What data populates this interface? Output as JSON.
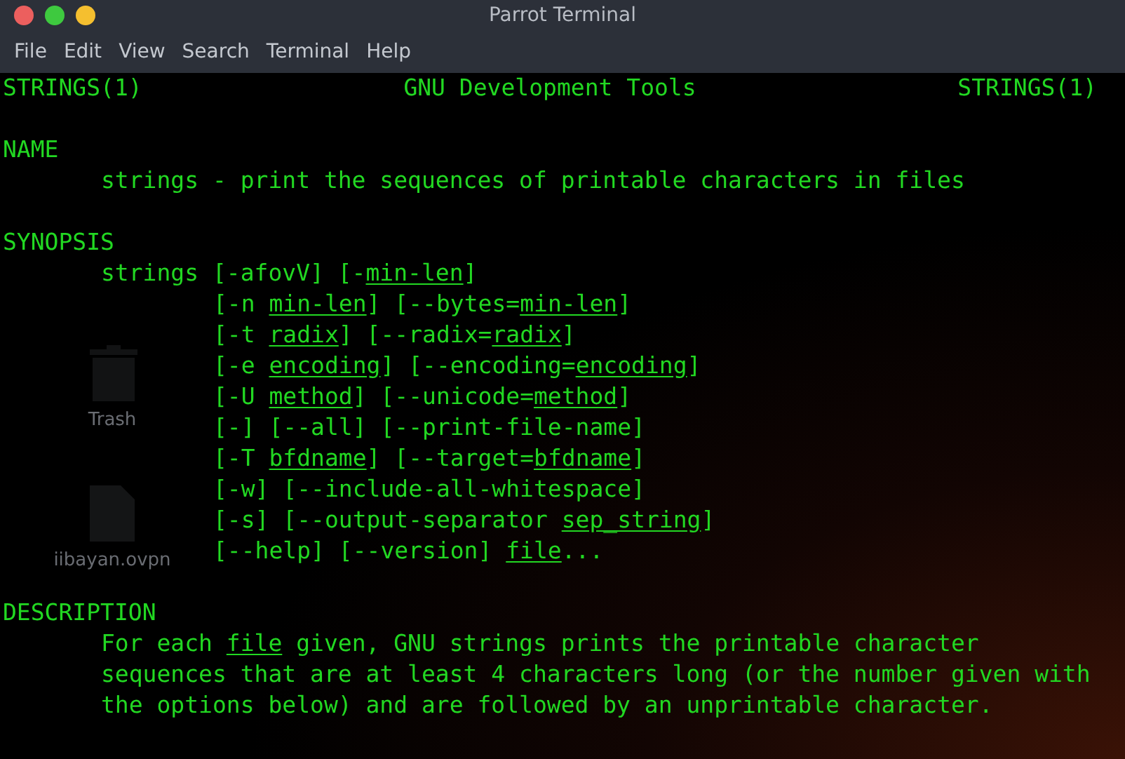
{
  "window": {
    "title": "Parrot Terminal"
  },
  "menu": [
    "File",
    "Edit",
    "View",
    "Search",
    "Terminal",
    "Help"
  ],
  "desktop_icons": [
    {
      "kind": "trash",
      "label": "Trash"
    },
    {
      "kind": "file",
      "label": "iibayan.ovpn"
    }
  ],
  "header": {
    "left": "STRINGS(1)",
    "center": "GNU Development Tools",
    "right": "STRINGS(1)"
  },
  "sections": [
    {
      "heading": "NAME",
      "lines": [
        {
          "kind": "text",
          "spans": [
            {
              "text": "strings - print the sequences of printable characters in files",
              "underlined": false
            }
          ]
        }
      ]
    },
    {
      "heading": "SYNOPSIS",
      "lines": [
        {
          "kind": "text",
          "spans": [
            {
              "text": "strings [-afovV] [-",
              "underlined": false
            },
            {
              "text": "min-len",
              "underlined": true
            },
            {
              "text": "]",
              "underlined": false
            }
          ]
        },
        {
          "kind": "continuation",
          "spans": [
            {
              "text": "[-n ",
              "underlined": false
            },
            {
              "text": "min-len",
              "underlined": true
            },
            {
              "text": "] [--bytes=",
              "underlined": false
            },
            {
              "text": "min-len",
              "underlined": true
            },
            {
              "text": "]",
              "underlined": false
            }
          ]
        },
        {
          "kind": "continuation",
          "spans": [
            {
              "text": "[-t ",
              "underlined": false
            },
            {
              "text": "radix",
              "underlined": true
            },
            {
              "text": "] [--radix=",
              "underlined": false
            },
            {
              "text": "radix",
              "underlined": true
            },
            {
              "text": "]",
              "underlined": false
            }
          ]
        },
        {
          "kind": "continuation",
          "spans": [
            {
              "text": "[-e ",
              "underlined": false
            },
            {
              "text": "encoding",
              "underlined": true
            },
            {
              "text": "] [--encoding=",
              "underlined": false
            },
            {
              "text": "encoding",
              "underlined": true
            },
            {
              "text": "]",
              "underlined": false
            }
          ]
        },
        {
          "kind": "continuation",
          "spans": [
            {
              "text": "[-U ",
              "underlined": false
            },
            {
              "text": "method",
              "underlined": true
            },
            {
              "text": "] [--unicode=",
              "underlined": false
            },
            {
              "text": "method",
              "underlined": true
            },
            {
              "text": "]",
              "underlined": false
            }
          ]
        },
        {
          "kind": "continuation",
          "spans": [
            {
              "text": "[-] [--all] [--print-file-name]",
              "underlined": false
            }
          ]
        },
        {
          "kind": "continuation",
          "spans": [
            {
              "text": "[-T ",
              "underlined": false
            },
            {
              "text": "bfdname",
              "underlined": true
            },
            {
              "text": "] [--target=",
              "underlined": false
            },
            {
              "text": "bfdname",
              "underlined": true
            },
            {
              "text": "]",
              "underlined": false
            }
          ]
        },
        {
          "kind": "continuation",
          "spans": [
            {
              "text": "[-w] [--include-all-whitespace]",
              "underlined": false
            }
          ]
        },
        {
          "kind": "continuation",
          "spans": [
            {
              "text": "[-s] [--output-separator ",
              "underlined": false
            },
            {
              "text": "sep_string",
              "underlined": true
            },
            {
              "text": "]",
              "underlined": false
            }
          ]
        },
        {
          "kind": "continuation",
          "spans": [
            {
              "text": "[--help] [--version] ",
              "underlined": false
            },
            {
              "text": "file",
              "underlined": true
            },
            {
              "text": "...",
              "underlined": false
            }
          ]
        }
      ]
    },
    {
      "heading": "DESCRIPTION",
      "lines": [
        {
          "kind": "text",
          "spans": [
            {
              "text": "For each ",
              "underlined": false
            },
            {
              "text": "file",
              "underlined": true
            },
            {
              "text": " given, GNU strings prints the printable character",
              "underlined": false
            }
          ]
        },
        {
          "kind": "text",
          "spans": [
            {
              "text": "sequences that are at least 4 characters long (or the number given with",
              "underlined": false
            }
          ]
        },
        {
          "kind": "text",
          "spans": [
            {
              "text": "the options below) and are followed by an unprintable character.",
              "underlined": false
            }
          ]
        }
      ]
    }
  ]
}
